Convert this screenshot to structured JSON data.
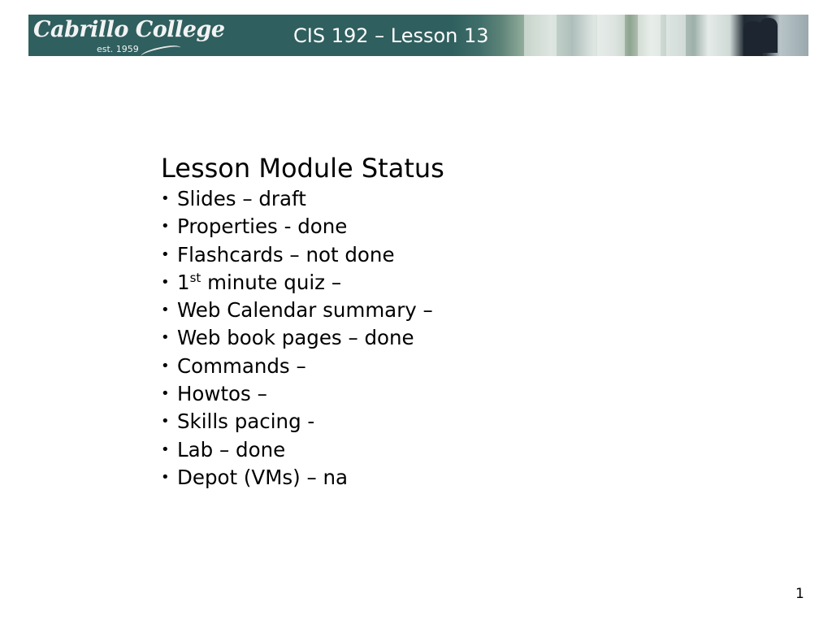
{
  "header": {
    "logo_text": "Cabrillo College",
    "logo_subtext": "est. 1959",
    "title": "CIS 192 – Lesson 13",
    "banner_color": "#2f5f5e"
  },
  "slide": {
    "heading": "Lesson Module Status",
    "items": [
      {
        "label": "Slides – draft"
      },
      {
        "label": "Properties - done"
      },
      {
        "label": "Flashcards – not done"
      },
      {
        "prefix": "1",
        "superscript": "st",
        "label": " minute quiz –"
      },
      {
        "label": "Web Calendar summary –"
      },
      {
        "label": "Web book pages – done"
      },
      {
        "label": "Commands –"
      },
      {
        "label": "Howtos –"
      },
      {
        "label": "Skills pacing -"
      },
      {
        "label": "Lab – done"
      },
      {
        "label": "Depot (VMs) – na"
      }
    ],
    "bullet": "•"
  },
  "footer": {
    "page_number": "1"
  }
}
